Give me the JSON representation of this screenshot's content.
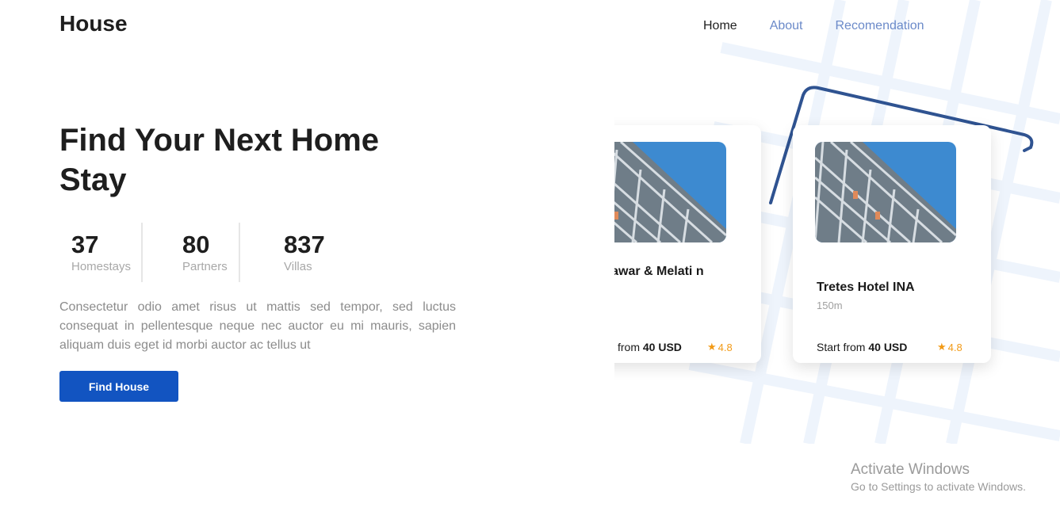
{
  "brand": "House",
  "nav": [
    {
      "label": "Home",
      "active": true
    },
    {
      "label": "About",
      "active": false
    },
    {
      "label": "Recomendation",
      "active": false
    }
  ],
  "hero": {
    "title": "Find Your Next Home Stay",
    "stats": [
      {
        "value": "37",
        "label": "Homestays"
      },
      {
        "value": "80",
        "label": "Partners"
      },
      {
        "value": "837",
        "label": "Villas"
      }
    ],
    "description": "Consectetur odio amet risus ut mattis sed tempor, sed luctus consequat in pellentesque neque nec auctor eu mi mauris, sapien aliquam duis eget id morbi auctor ac tellus ut",
    "button_label": "Find House"
  },
  "cards": [
    {
      "name": "el Mawar & Melati n",
      "distance": "",
      "price_prefix": "from",
      "price": "40 USD",
      "rating": "4.8"
    },
    {
      "name": "Tretes Hotel INA",
      "distance": "150m",
      "price_prefix": "Start from",
      "price": "40 USD",
      "rating": "4.8"
    }
  ],
  "colors": {
    "accent": "#1254c1",
    "nav_link": "#6b8ac9",
    "rating": "#f29a16"
  },
  "windows_notice": {
    "title": "Activate Windows",
    "subtitle": "Go to Settings to activate Windows."
  }
}
